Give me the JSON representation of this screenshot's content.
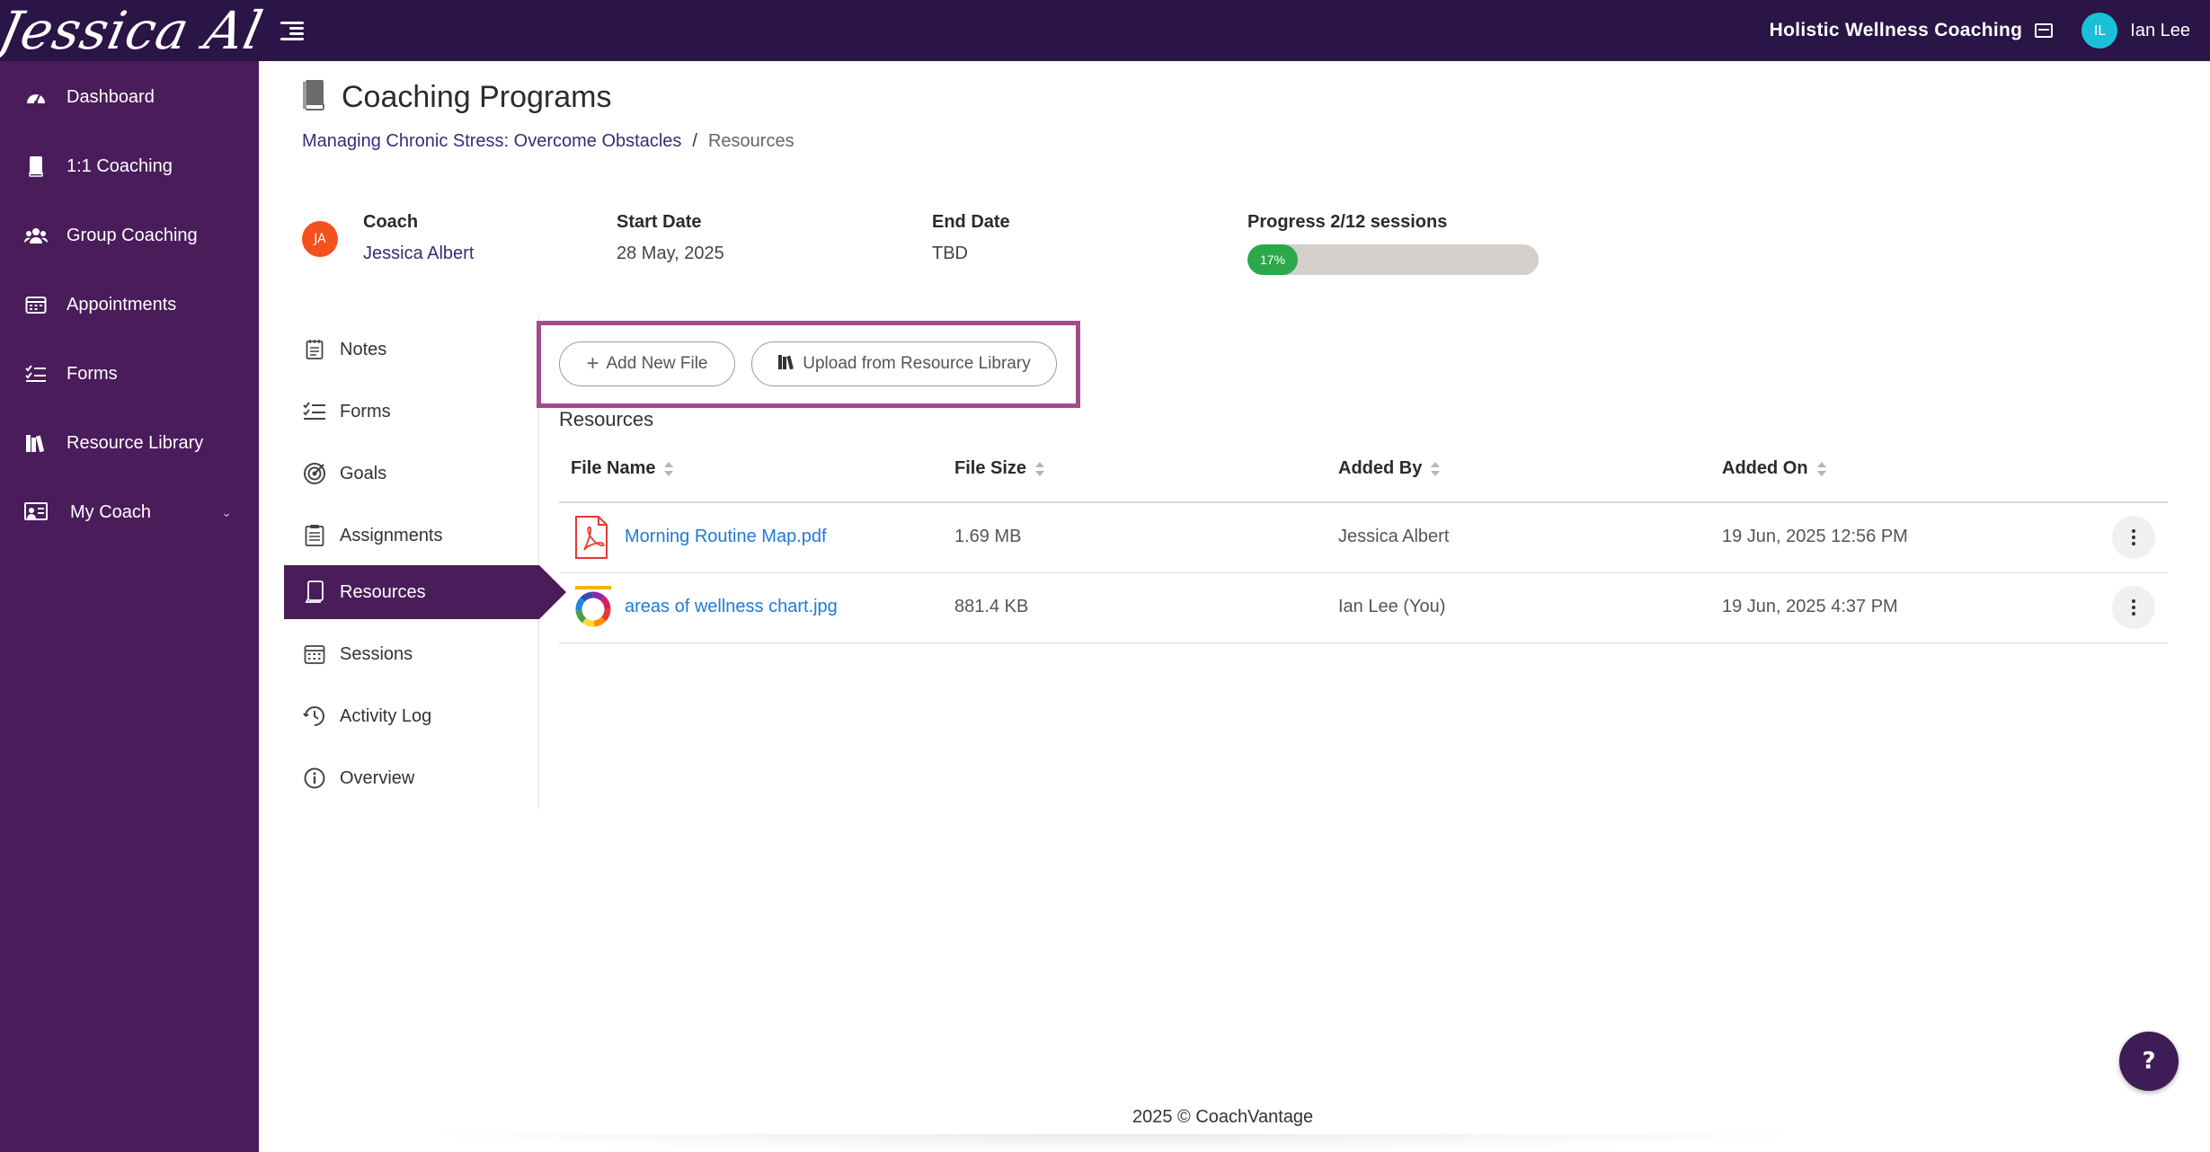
{
  "header": {
    "brand": "Jessica Albert",
    "organization": "Holistic Wellness Coaching",
    "user_initials": "IL",
    "user_name": "Ian Lee"
  },
  "sidebar": {
    "items": [
      {
        "label": "Dashboard",
        "icon": "dashboard-icon"
      },
      {
        "label": "1:1 Coaching",
        "icon": "book-icon"
      },
      {
        "label": "Group Coaching",
        "icon": "users-icon"
      },
      {
        "label": "Appointments",
        "icon": "calendar-icon"
      },
      {
        "label": "Forms",
        "icon": "checklist-icon"
      },
      {
        "label": "Resource Library",
        "icon": "library-icon"
      },
      {
        "label": "My Coach",
        "icon": "coach-board-icon"
      }
    ]
  },
  "page": {
    "title": "Coaching Programs",
    "breadcrumb": {
      "program": "Managing Chronic Stress: Overcome Obstacles",
      "separator": "/",
      "current": "Resources"
    }
  },
  "info": {
    "coach_initials": "JA",
    "coach_label": "Coach",
    "coach_name": "Jessica Albert",
    "start_label": "Start Date",
    "start_value": "28 May, 2025",
    "end_label": "End Date",
    "end_value": "TBD",
    "progress_label": "Progress 2/12 sessions",
    "progress_text": "17%",
    "progress_fraction": 0.17
  },
  "tabs": [
    {
      "label": "Notes",
      "icon": "notepad-icon"
    },
    {
      "label": "Forms",
      "icon": "checklist-icon"
    },
    {
      "label": "Goals",
      "icon": "target-icon"
    },
    {
      "label": "Assignments",
      "icon": "clipboard-icon"
    },
    {
      "label": "Resources",
      "icon": "tablet-icon",
      "active": true
    },
    {
      "label": "Sessions",
      "icon": "calendar-icon"
    },
    {
      "label": "Activity Log",
      "icon": "clock-icon"
    },
    {
      "label": "Overview",
      "icon": "info-icon"
    }
  ],
  "actions": {
    "add_new_file": "Add New File",
    "upload_from_library": "Upload from Resource Library"
  },
  "resources": {
    "title": "Resources",
    "columns": [
      "File Name",
      "File Size",
      "Added By",
      "Added On"
    ],
    "rows": [
      {
        "file_name": "Morning Routine Map.pdf",
        "file_size": "1.69 MB",
        "added_by": "Jessica Albert",
        "added_on": "19 Jun, 2025 12:56 PM",
        "icon": "pdf-file-icon"
      },
      {
        "file_name": "areas of wellness chart.jpg",
        "file_size": "881.4 KB",
        "added_by": "Ian Lee (You)",
        "added_on": "19 Jun, 2025 4:37 PM",
        "icon": "wellness-wheel-image-icon"
      }
    ]
  },
  "footer": {
    "text": "2025 © CoachVantage"
  },
  "help": {
    "label": "?"
  },
  "colors": {
    "topbar": "#2b1446",
    "sidebar": "#4a1c5a",
    "highlight_border": "#a44a8d",
    "progress_fill": "#2aa84a",
    "link": "#1e7ad6"
  }
}
